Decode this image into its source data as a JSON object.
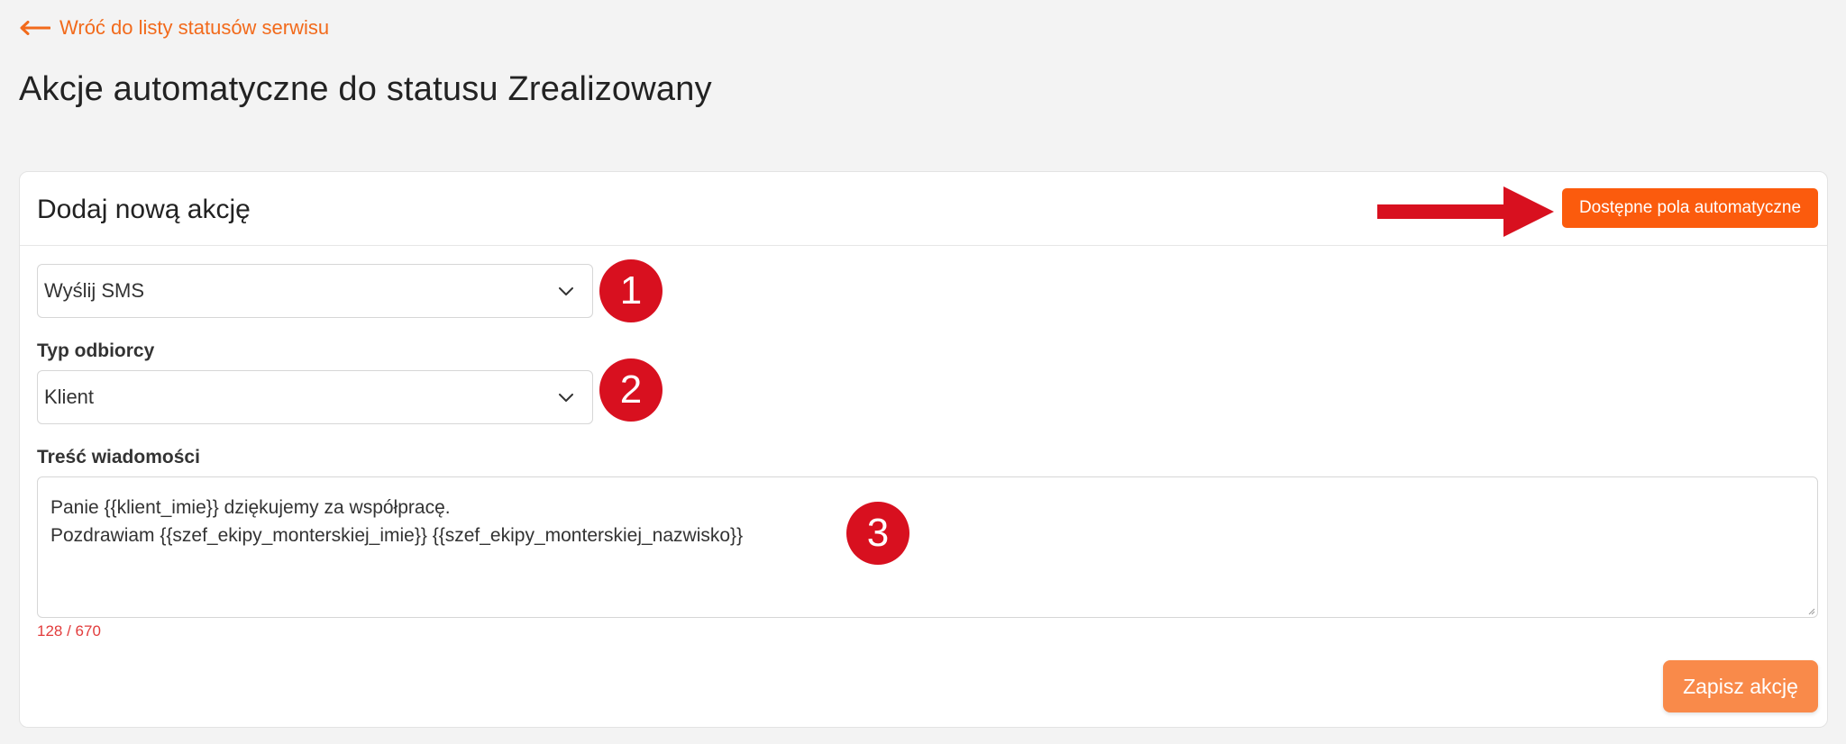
{
  "nav": {
    "back_label": "Wróć do listy statusów serwisu",
    "back_icon": "arrow-left-icon"
  },
  "page": {
    "title": "Akcje automatyczne do statusu Zrealizowany"
  },
  "card": {
    "title": "Dodaj nową akcję",
    "auto_fields_button": "Dostępne pola automatyczne",
    "action_select": {
      "value": "Wyślij SMS",
      "icon": "chevron-down-icon"
    },
    "recipient": {
      "label": "Typ odbiorcy",
      "value": "Klient",
      "icon": "chevron-down-icon"
    },
    "message": {
      "label": "Treść wiadomości",
      "lines": [
        "Panie {{klient_imie}} dziękujemy za współpracę.",
        "Pozdrawiam {{szef_ekipy_monterskiej_imie}} {{szef_ekipy_monterskiej_nazwisko}}"
      ],
      "char_count": "128 / 670"
    },
    "save_button": "Zapisz akcję"
  },
  "annotations": {
    "badges": [
      "1",
      "2",
      "3"
    ],
    "badge_color": "#d8101f",
    "arrow_icon": "red-arrow-right-icon"
  },
  "colors": {
    "accent": "#fb5b0d",
    "link": "#f26a1b",
    "save_button": "#f98a4a",
    "counter": "#e23c3c"
  }
}
